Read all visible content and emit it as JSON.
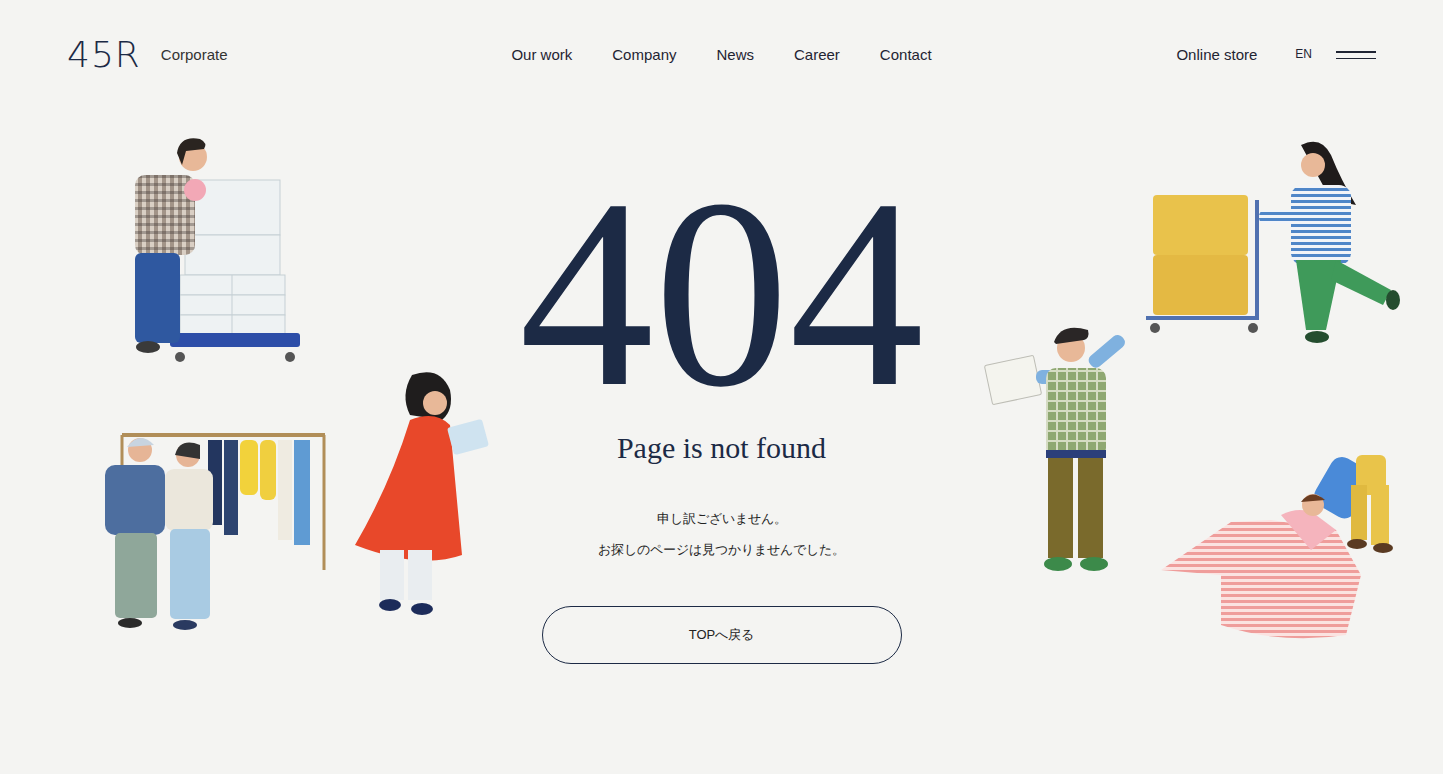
{
  "header": {
    "logo": "45R",
    "logo_sub": "Corporate",
    "nav": [
      "Our work",
      "Company",
      "News",
      "Career",
      "Contact"
    ],
    "online_store": "Online store",
    "language": "EN"
  },
  "error": {
    "code": "404",
    "title": "Page is not found",
    "messages": [
      "申し訳ございません。",
      "お探しのページは見つかりませんでした。"
    ],
    "button": "TOPへ戻る"
  }
}
